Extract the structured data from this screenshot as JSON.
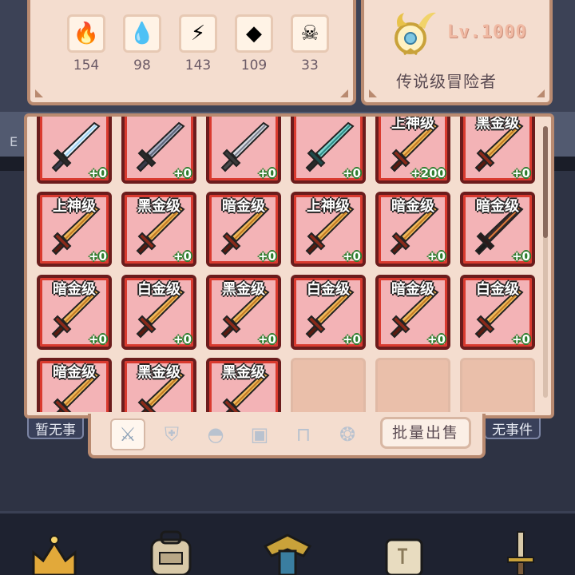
{
  "resources": [
    {
      "name": "fire-gem-icon",
      "glyph": "🔥",
      "value": "154"
    },
    {
      "name": "water-gem-icon",
      "glyph": "💧",
      "value": "98"
    },
    {
      "name": "lightning-gem-icon",
      "glyph": "⚡",
      "value": "143"
    },
    {
      "name": "earth-gem-icon",
      "glyph": "◆",
      "value": "109"
    },
    {
      "name": "skull-icon",
      "glyph": "☠",
      "value": "33"
    }
  ],
  "player": {
    "level": "Lv.1000",
    "rank_title": "传说级冒险者"
  },
  "background": {
    "left_label": "E",
    "left_event": "暂无事",
    "right_event": "无事件"
  },
  "inventory": {
    "items": [
      {
        "tier": "",
        "bonus": "+0",
        "sword": "ice"
      },
      {
        "tier": "",
        "bonus": "+0",
        "sword": "steel"
      },
      {
        "tier": "",
        "bonus": "+0",
        "sword": "silver"
      },
      {
        "tier": "",
        "bonus": "+0",
        "sword": "cyan"
      },
      {
        "tier": "上神级",
        "bonus": "+200",
        "sword": "gold"
      },
      {
        "tier": "黑金级",
        "bonus": "+0",
        "sword": "gold"
      },
      {
        "tier": "上神级",
        "bonus": "+0",
        "sword": "gold"
      },
      {
        "tier": "黑金级",
        "bonus": "+0",
        "sword": "gold"
      },
      {
        "tier": "暗金级",
        "bonus": "+0",
        "sword": "gold"
      },
      {
        "tier": "上神级",
        "bonus": "+0",
        "sword": "gold"
      },
      {
        "tier": "暗金级",
        "bonus": "+0",
        "sword": "gold"
      },
      {
        "tier": "暗金级",
        "bonus": "+0",
        "sword": "dark"
      },
      {
        "tier": "暗金级",
        "bonus": "+0",
        "sword": "gold"
      },
      {
        "tier": "白金级",
        "bonus": "+0",
        "sword": "gold"
      },
      {
        "tier": "黑金级",
        "bonus": "+0",
        "sword": "gold"
      },
      {
        "tier": "白金级",
        "bonus": "+0",
        "sword": "gold"
      },
      {
        "tier": "暗金级",
        "bonus": "+0",
        "sword": "gold"
      },
      {
        "tier": "白金级",
        "bonus": "+0",
        "sword": "gold"
      },
      {
        "tier": "暗金级",
        "bonus": "",
        "sword": "gold"
      },
      {
        "tier": "黑金级",
        "bonus": "",
        "sword": "gold"
      },
      {
        "tier": "黑金级",
        "bonus": "",
        "sword": "gold"
      },
      {
        "tier": "",
        "bonus": "",
        "sword": "empty"
      },
      {
        "tier": "",
        "bonus": "",
        "sword": "empty"
      },
      {
        "tier": "",
        "bonus": "",
        "sword": "empty"
      }
    ]
  },
  "tabs": [
    {
      "name": "tab-weapons",
      "glyph": "⚔",
      "active": true
    },
    {
      "name": "tab-armor",
      "glyph": "⛨",
      "active": false
    },
    {
      "name": "tab-helmet",
      "glyph": "◓",
      "active": false
    },
    {
      "name": "tab-chest",
      "glyph": "▣",
      "active": false
    },
    {
      "name": "tab-pants",
      "glyph": "⊓",
      "active": false
    },
    {
      "name": "tab-accessory",
      "glyph": "❂",
      "active": false
    }
  ],
  "sell_button": "批量出售",
  "colors": {
    "panel": "#f4ddcf",
    "panel_border": "#b98a70",
    "cell_bg": "#f3b3b6",
    "cell_border": "#6b1c1c",
    "bonus_green": "#2e7d2e"
  }
}
